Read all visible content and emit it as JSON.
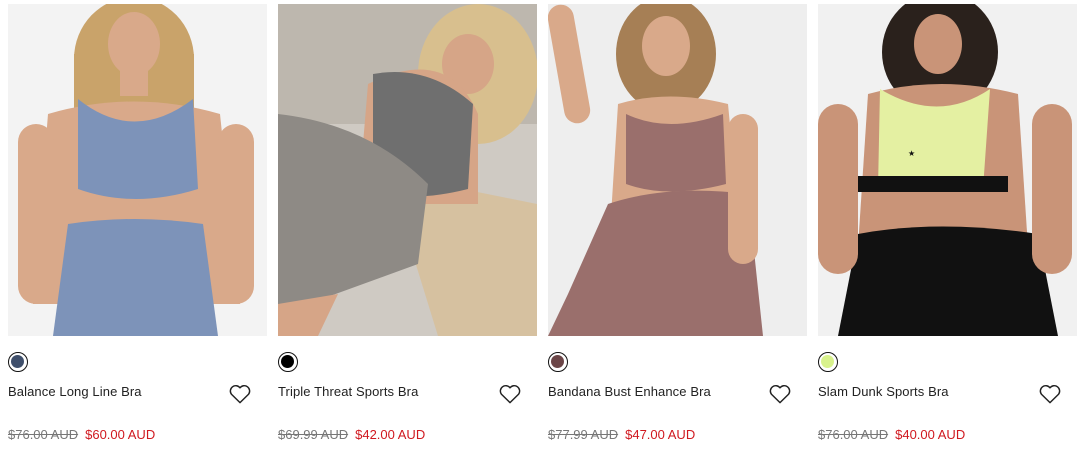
{
  "products": [
    {
      "name": "Balance Long Line Bra",
      "was_price": "$76.00 AUD",
      "price": "$60.00 AUD",
      "swatch_color": "#3f4f6b",
      "image_subject": "model in blue long line sports bra and leggings",
      "colors": {
        "bg": "#f3f3f3",
        "skin": "#d9a98a",
        "hair": "#c9a36a",
        "garment": "#7d93b9",
        "bottom": "#7d93b9"
      }
    },
    {
      "name": "Triple Threat Sports Bra",
      "was_price": "$69.99 AUD",
      "price": "$42.00 AUD",
      "swatch_color": "#000000",
      "image_subject": "model lying down in grey sports bra and snake print leggings",
      "colors": {
        "bg": "#cfcac3",
        "skin": "#d6a587",
        "hair": "#d8bf8e",
        "garment": "#6f6f6f",
        "bottom": "#8e8a85"
      }
    },
    {
      "name": "Bandana Bust Enhance Bra",
      "was_price": "$77.99 AUD",
      "price": "$47.00 AUD",
      "swatch_color": "#6b4547",
      "image_subject": "model in pink bandana print sports bra and leggings",
      "colors": {
        "bg": "#eeeeee",
        "skin": "#d9a98a",
        "hair": "#a67f55",
        "garment": "#9a6f6c",
        "bottom": "#9a6f6c"
      }
    },
    {
      "name": "Slam Dunk Sports Bra",
      "was_price": "$76.00 AUD",
      "price": "$40.00 AUD",
      "swatch_color": "#d8f28c",
      "image_subject": "model in lime sports bra and black leggings",
      "colors": {
        "bg": "#f1f1f1",
        "skin": "#c99478",
        "hair": "#2a211c",
        "garment": "#e4f0a2",
        "bottom": "#111111"
      }
    }
  ]
}
